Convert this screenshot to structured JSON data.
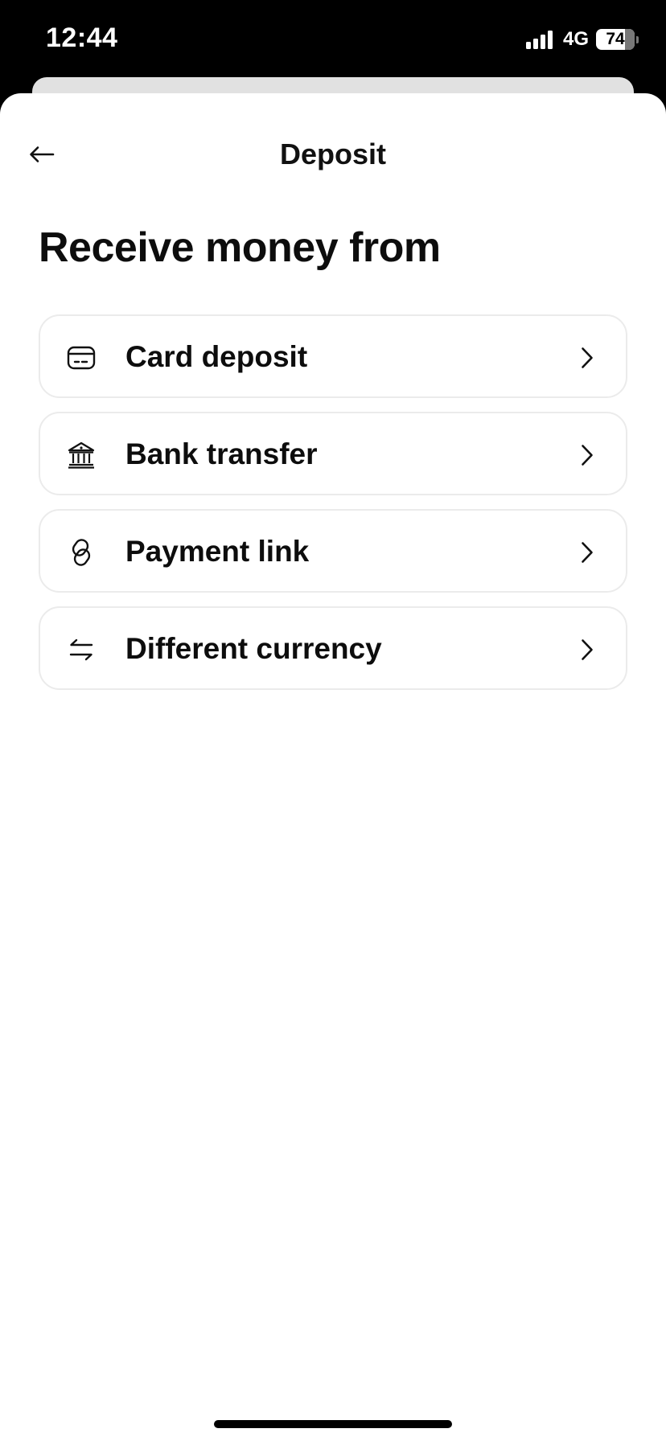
{
  "status_bar": {
    "time": "12:44",
    "network": "4G",
    "battery_percent": "74"
  },
  "nav": {
    "title": "Deposit",
    "back_icon": "arrow-left-icon"
  },
  "heading": "Receive money from",
  "options": [
    {
      "label": "Card deposit",
      "icon": "card-icon"
    },
    {
      "label": "Bank transfer",
      "icon": "bank-icon"
    },
    {
      "label": "Payment link",
      "icon": "link-icon"
    },
    {
      "label": "Different currency",
      "icon": "exchange-icon"
    }
  ],
  "colors": {
    "text": "#0d0d0d",
    "border": "#ebebeb",
    "background": "#ffffff",
    "status_bar": "#000000"
  }
}
